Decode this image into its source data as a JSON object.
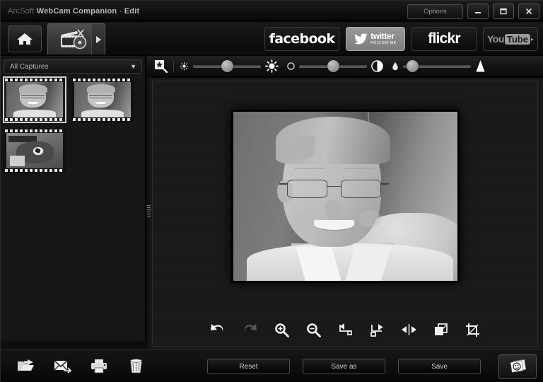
{
  "window": {
    "title_app": "ArcSoft",
    "title_product": "WebCam Companion",
    "title_sep": "-",
    "title_mode": "Edit",
    "options_button": "Options",
    "minimize_icon": "minimize-icon",
    "maximize_icon": "maximize-icon",
    "close_icon": "close-icon"
  },
  "tabbar": {
    "home_icon": "home-icon",
    "edit_tab_icon": "film-clapper-icon",
    "tab_arrow_icon": "chevron-right-icon",
    "social": {
      "facebook": "facebook",
      "twitter_name": "twitter",
      "twitter_sub": "FOLLOW ME",
      "twitter_icon": "twitter-bird-icon",
      "flickr": "flickr",
      "youtube_you": "You",
      "youtube_tube": "Tube",
      "youtube_tail": "▸"
    }
  },
  "sidebar": {
    "filter_label": "All Captures",
    "filter_caret_icon": "chevron-down-icon",
    "thumbnails": [
      {
        "name": "thumbnail-portrait-1",
        "kind": "portrait",
        "selected": true
      },
      {
        "name": "thumbnail-portrait-2",
        "kind": "portrait",
        "selected": false
      },
      {
        "name": "thumbnail-soccer",
        "kind": "soccer",
        "selected": false
      }
    ]
  },
  "adjust_toolbar": {
    "auto_enhance_icon": "magic-wand-icon",
    "sliders": [
      {
        "name": "brightness",
        "left_icon": "small-sun-icon",
        "right_icon": "large-sun-icon",
        "value": 50
      },
      {
        "name": "contrast",
        "left_icon": "small-contrast-circle-icon",
        "right_icon": "large-contrast-circle-icon",
        "value": 50
      },
      {
        "name": "saturation",
        "left_icon": "small-droplet-icon",
        "right_icon": "large-droplet-icon",
        "value": 6
      }
    ]
  },
  "canvas": {
    "photo_alt": "black-and-white portrait of smiling man with glasses",
    "splitter_icon": "splitter-grip-icon"
  },
  "edit_tools": [
    {
      "name": "undo-button",
      "icon": "undo-icon",
      "enabled": true
    },
    {
      "name": "redo-button",
      "icon": "redo-icon",
      "enabled": false
    },
    {
      "name": "zoom-in-button",
      "icon": "zoom-in-icon",
      "enabled": true
    },
    {
      "name": "zoom-out-button",
      "icon": "zoom-out-icon",
      "enabled": true
    },
    {
      "name": "rotate-left-button",
      "icon": "rotate-left-icon",
      "enabled": true
    },
    {
      "name": "rotate-right-button",
      "icon": "rotate-right-icon",
      "enabled": true
    },
    {
      "name": "flip-horizontal-button",
      "icon": "flip-horizontal-icon",
      "enabled": true
    },
    {
      "name": "resize-button",
      "icon": "resize-icon",
      "enabled": true
    },
    {
      "name": "crop-button",
      "icon": "crop-icon",
      "enabled": true
    }
  ],
  "bottombar": {
    "icons": [
      {
        "name": "export-button",
        "icon": "open-folder-arrow-icon"
      },
      {
        "name": "email-button",
        "icon": "envelope-arrow-icon"
      },
      {
        "name": "print-button",
        "icon": "printer-icon"
      },
      {
        "name": "delete-button",
        "icon": "trash-icon"
      }
    ],
    "reset_label": "Reset",
    "save_as_label": "Save as",
    "save_label": "Save",
    "capture_icon": "photo-stack-icon"
  },
  "colors": {
    "window_bg": "#0a0a0a",
    "panel_bg": "#171717",
    "accent_text": "#d9d9d9",
    "selection_border": "#cfcfcf",
    "twitter_button": "#8d8d8d"
  }
}
